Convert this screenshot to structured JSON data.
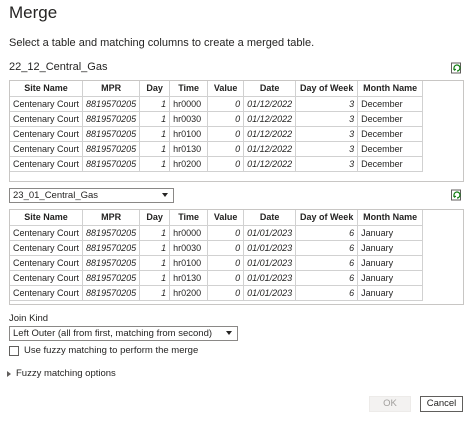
{
  "dialog": {
    "title": "Merge",
    "subtitle": "Select a table and matching columns to create a merged table."
  },
  "table1": {
    "name": "22_12_Central_Gas",
    "headers": [
      "Site Name",
      "MPR",
      "Day",
      "Time",
      "Value",
      "Date",
      "Day of Week",
      "Month Name"
    ],
    "rows": [
      [
        "Centenary Court",
        "8819570205",
        "1",
        "hr0000",
        "0",
        "01/12/2022",
        "3",
        "December"
      ],
      [
        "Centenary Court",
        "8819570205",
        "1",
        "hr0030",
        "0",
        "01/12/2022",
        "3",
        "December"
      ],
      [
        "Centenary Court",
        "8819570205",
        "1",
        "hr0100",
        "0",
        "01/12/2022",
        "3",
        "December"
      ],
      [
        "Centenary Court",
        "8819570205",
        "1",
        "hr0130",
        "0",
        "01/12/2022",
        "3",
        "December"
      ],
      [
        "Centenary Court",
        "8819570205",
        "1",
        "hr0200",
        "0",
        "01/12/2022",
        "3",
        "December"
      ]
    ]
  },
  "table2": {
    "selected": "23_01_Central_Gas",
    "headers": [
      "Site Name",
      "MPR",
      "Day",
      "Time",
      "Value",
      "Date",
      "Day of Week",
      "Month Name"
    ],
    "rows": [
      [
        "Centenary Court",
        "8819570205",
        "1",
        "hr0000",
        "0",
        "01/01/2023",
        "6",
        "January"
      ],
      [
        "Centenary Court",
        "8819570205",
        "1",
        "hr0030",
        "0",
        "01/01/2023",
        "6",
        "January"
      ],
      [
        "Centenary Court",
        "8819570205",
        "1",
        "hr0100",
        "0",
        "01/01/2023",
        "6",
        "January"
      ],
      [
        "Centenary Court",
        "8819570205",
        "1",
        "hr0130",
        "0",
        "01/01/2023",
        "6",
        "January"
      ],
      [
        "Centenary Court",
        "8819570205",
        "1",
        "hr0200",
        "0",
        "01/01/2023",
        "6",
        "January"
      ]
    ]
  },
  "join": {
    "label": "Join Kind",
    "selected": "Left Outer (all from first, matching from second)"
  },
  "fuzzy": {
    "checkbox_label": "Use fuzzy matching to perform the merge",
    "options_label": "Fuzzy matching options"
  },
  "buttons": {
    "ok": "OK",
    "cancel": "Cancel"
  },
  "icons": {
    "refresh": "refresh-preview-icon",
    "dropdown": "chevron-down-icon",
    "expand": "expand-triangle-icon"
  }
}
